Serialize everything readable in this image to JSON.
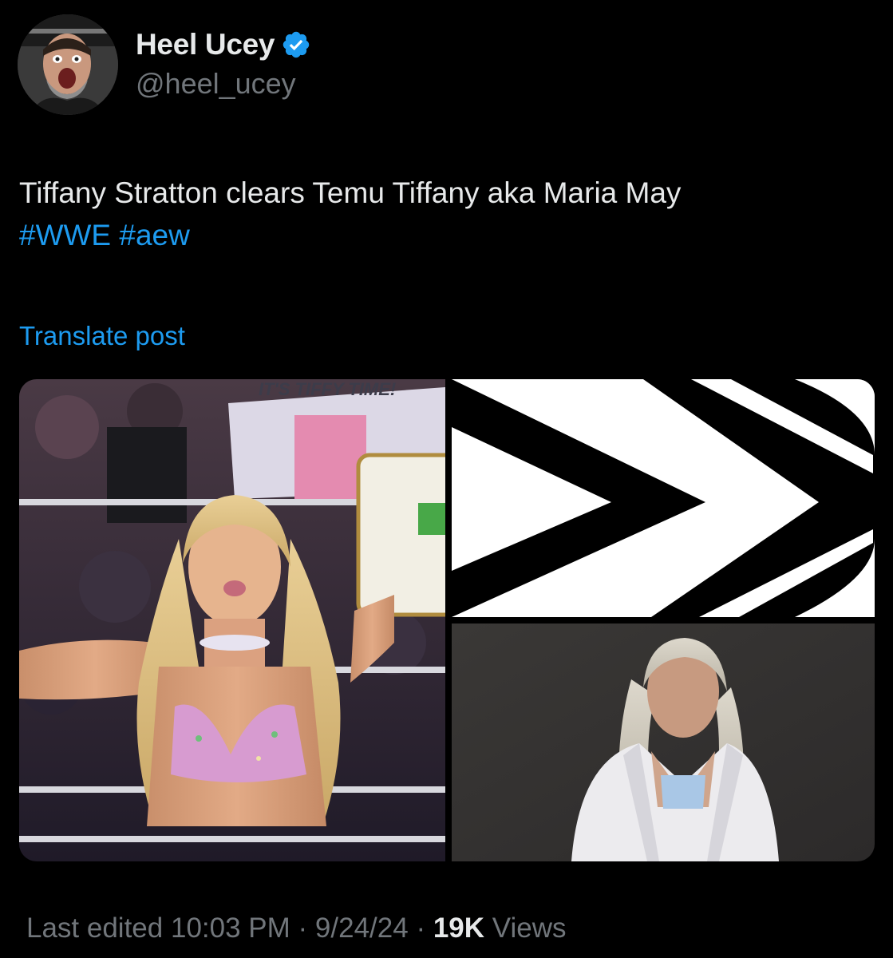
{
  "author": {
    "display_name": "Heel Ucey",
    "handle": "@heel_ucey",
    "verified": true,
    "avatar_icon": "profile-photo",
    "verified_icon": "verified-badge-icon"
  },
  "tweet": {
    "text": "Tiffany Stratton clears Temu Tiffany aka Maria May",
    "hashtags": [
      "#WWE",
      "#aew"
    ],
    "translate_label": "Translate post"
  },
  "media": {
    "images": [
      {
        "name": "wrestler-holding-briefcase-photo",
        "sign_text": "IT'S TIFFY TIME!"
      },
      {
        "name": "aew-logo-image"
      },
      {
        "name": "woman-in-white-jacket-photo"
      }
    ]
  },
  "footer": {
    "edited_label": "Last edited",
    "time": "10:03 PM",
    "separator": "·",
    "date": "9/24/24",
    "views_count": "19K",
    "views_label": "Views"
  },
  "colors": {
    "background": "#000000",
    "text": "#e7e9ea",
    "secondary_text": "#71767b",
    "accent": "#1d9bf0"
  }
}
